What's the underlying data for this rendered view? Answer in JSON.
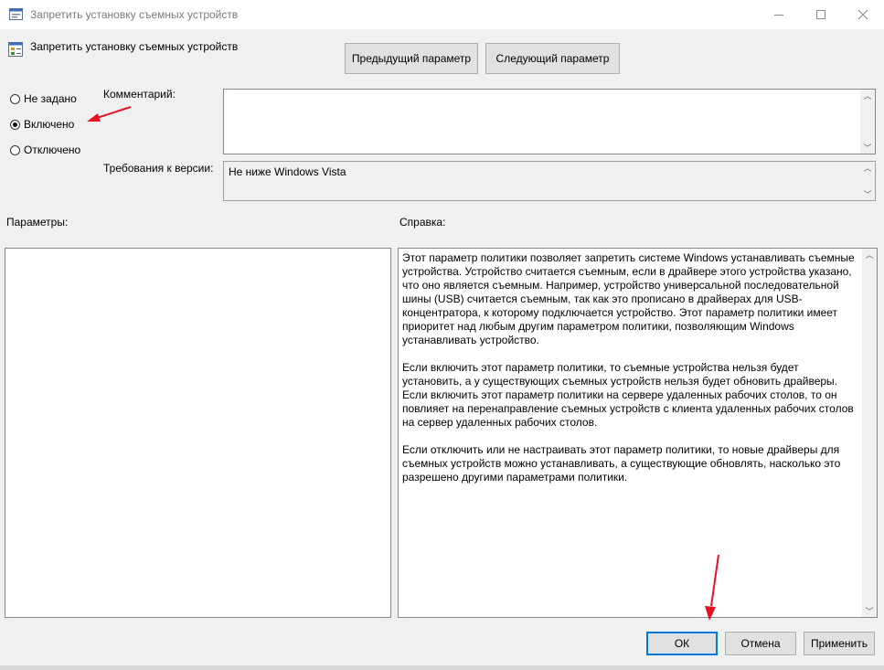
{
  "window": {
    "title": "Запретить установку съемных устройств",
    "icon": "policy-icon",
    "controls": [
      "minimize",
      "maximize",
      "close"
    ]
  },
  "header": {
    "policy_name": "Запретить установку съемных устройств",
    "prev_button": "Предыдущий параметр",
    "next_button": "Следующий параметр"
  },
  "state": {
    "options": [
      {
        "label": "Не задано",
        "selected": false
      },
      {
        "label": "Включено",
        "selected": true
      },
      {
        "label": "Отключено",
        "selected": false
      }
    ]
  },
  "comment": {
    "label": "Комментарий:",
    "value": ""
  },
  "supported": {
    "label": "Требования к версии:",
    "value": "Не ниже Windows Vista"
  },
  "options_panel": {
    "label": "Параметры:"
  },
  "help_panel": {
    "label": "Справка:",
    "paragraphs": [
      "Этот параметр политики позволяет запретить системе Windows устанавливать съемные устройства. Устройство считается съемным, если в драйвере этого устройства указано, что оно является съемным. Например, устройство универсальной последовательной шины (USB) считается съемным, так как это прописано в драйверах для USB-концентратора, к которому подключается устройство. Этот параметр политики имеет приоритет над любым другим параметром политики, позволяющим Windows устанавливать устройство.",
      "Если включить этот параметр политики, то съемные устройства нельзя будет установить, а у существующих съемных устройств нельзя будет обновить драйверы. Если включить этот параметр политики на сервере удаленных рабочих столов, то он повлияет на перенаправление съемных устройств с клиента удаленных рабочих столов на сервер удаленных рабочих столов.",
      "Если отключить или не настраивать этот параметр политики, то новые драйверы для съемных устройств можно устанавливать, а существующие обновлять, насколько это разрешено другими параметрами политики."
    ]
  },
  "footer": {
    "ok": "ОК",
    "cancel": "Отмена",
    "apply": "Применить"
  },
  "annotations": {
    "arrow_color": "#e81123"
  }
}
